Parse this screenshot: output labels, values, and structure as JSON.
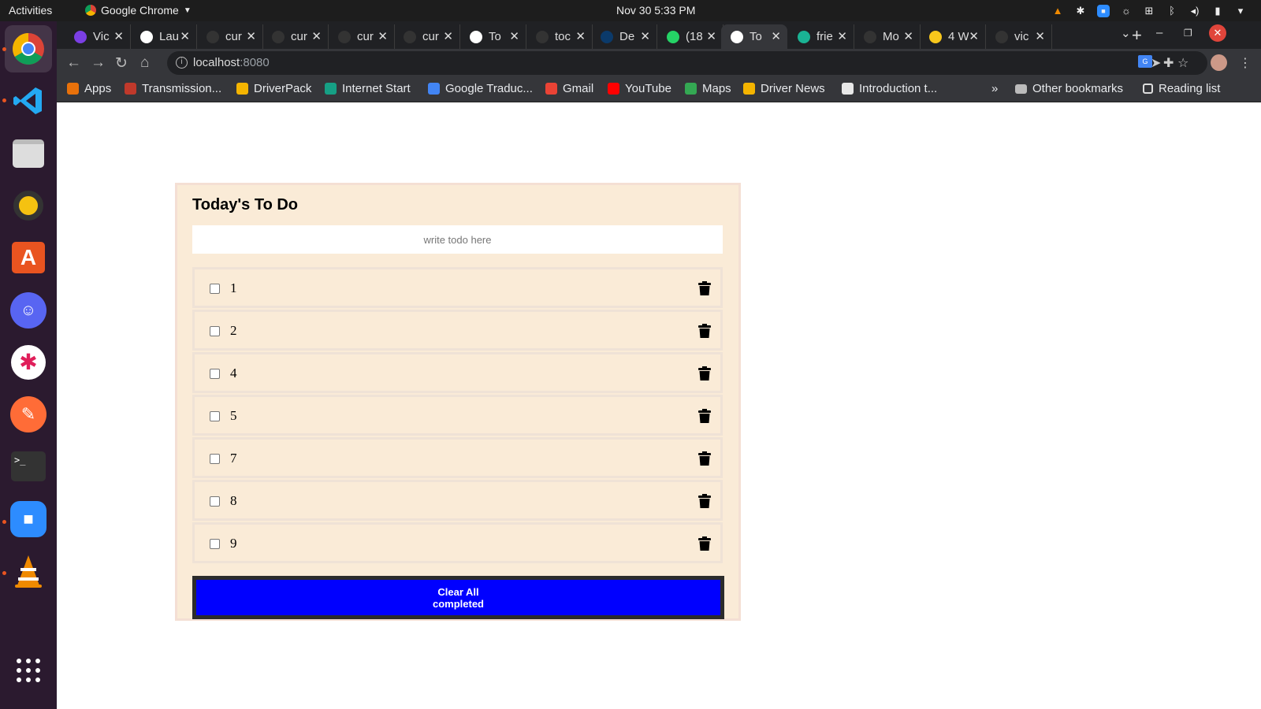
{
  "os": {
    "activities": "Activities",
    "app_menu": "Google Chrome",
    "clock": "Nov 30  5:33 PM"
  },
  "tabs": [
    {
      "label": "Vic",
      "color": "#7b3fe4"
    },
    {
      "label": "Lau",
      "color": "#ffffff"
    },
    {
      "label": "cur",
      "color": "#333333"
    },
    {
      "label": "cur",
      "color": "#333333"
    },
    {
      "label": "cur",
      "color": "#333333"
    },
    {
      "label": "cur",
      "color": "#333333"
    },
    {
      "label": "To",
      "color": "#ffffff"
    },
    {
      "label": "toc",
      "color": "#333333"
    },
    {
      "label": "De",
      "color": "#0b3a6a"
    },
    {
      "label": "(18",
      "color": "#25d366"
    },
    {
      "label": "To",
      "color": "#ffffff",
      "active": true
    },
    {
      "label": "frie",
      "color": "#1ab394"
    },
    {
      "label": "Mo",
      "color": "#333333"
    },
    {
      "label": "4 W",
      "color": "#f7c71c"
    },
    {
      "label": "vic",
      "color": "#333333"
    }
  ],
  "address_bar": {
    "host": "localhost",
    "port": ":8080"
  },
  "bookmarks": [
    {
      "label": "Apps",
      "color": "#e8710a"
    },
    {
      "label": "Transmission...",
      "color": "#c0392b"
    },
    {
      "label": "DriverPack",
      "color": "#f4b400"
    },
    {
      "label": "Internet Start",
      "color": "#16a085"
    },
    {
      "label": "Google Traduc...",
      "color": "#4285f4"
    },
    {
      "label": "Gmail",
      "color": "#ea4335"
    },
    {
      "label": "YouTube",
      "color": "#ff0000"
    },
    {
      "label": "Maps",
      "color": "#34a853"
    },
    {
      "label": "Driver News",
      "color": "#f4b400"
    },
    {
      "label": "Introduction t...",
      "color": "#e8e8e8"
    }
  ],
  "other_bookmarks": "Other bookmarks",
  "reading_list": "Reading list",
  "todo_app": {
    "title": "Today's To Do",
    "input_placeholder": "write todo here",
    "items": [
      {
        "text": "1",
        "checked": false
      },
      {
        "text": "2",
        "checked": false
      },
      {
        "text": "4",
        "checked": false
      },
      {
        "text": "5",
        "checked": false
      },
      {
        "text": "7",
        "checked": false
      },
      {
        "text": "8",
        "checked": false
      },
      {
        "text": "9",
        "checked": false
      }
    ],
    "clear_button": "Clear All completed",
    "accent_color": "#0000ff",
    "background_color": "#faebd7"
  }
}
